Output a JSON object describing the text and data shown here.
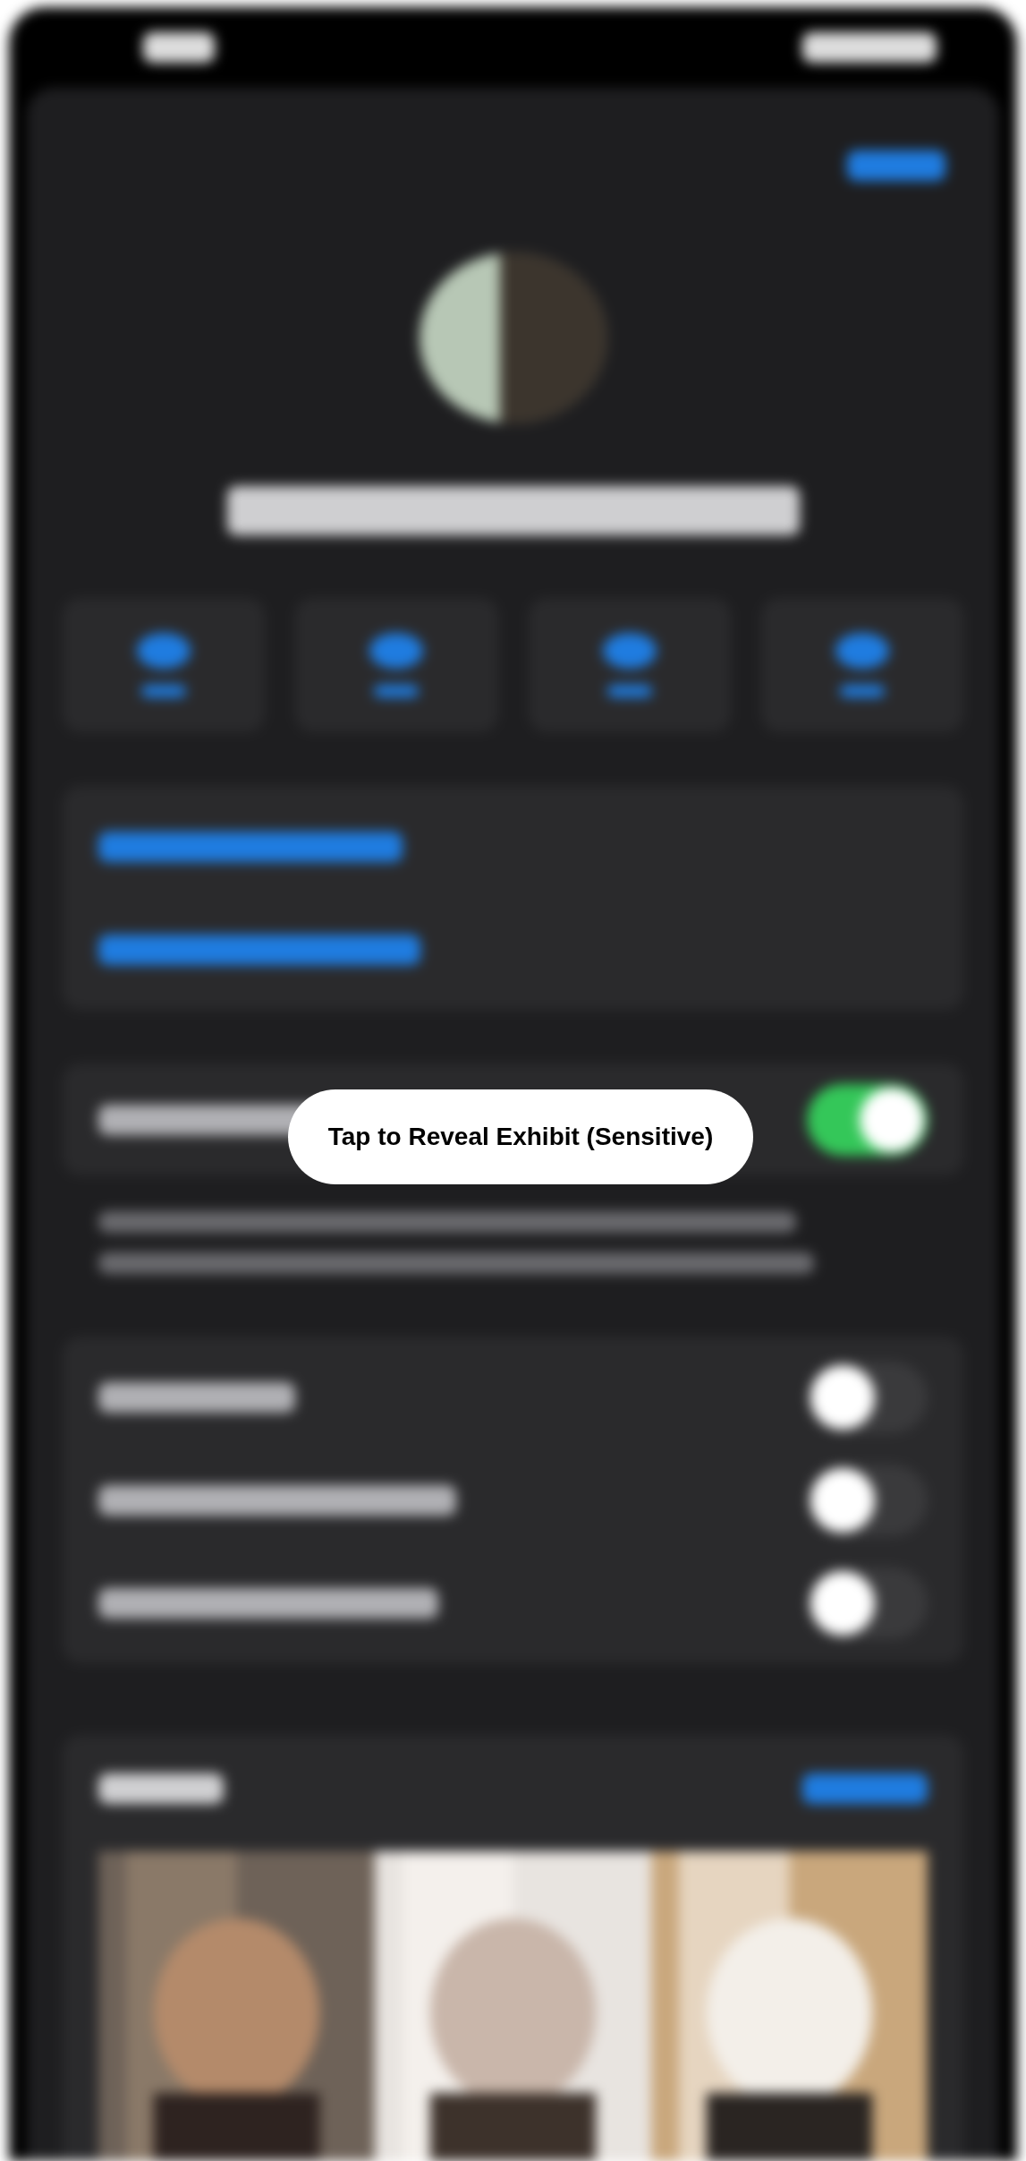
{
  "contact_card": {
    "toggles": [
      {
        "on": true
      },
      {
        "on": false
      },
      {
        "on": false
      },
      {
        "on": false
      }
    ]
  },
  "reveal_overlay": {
    "label": "Tap to Reveal Exhibit (Sensitive)"
  }
}
